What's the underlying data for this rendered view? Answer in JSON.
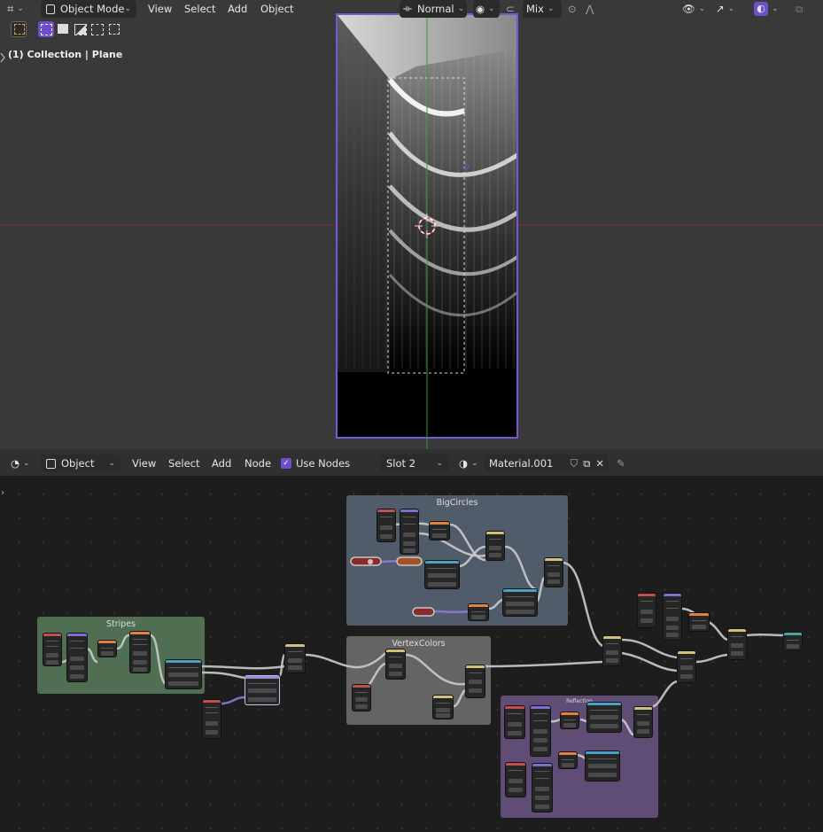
{
  "viewport": {
    "header": {
      "mode_label": "Object Mode",
      "menus": [
        "View",
        "Select",
        "Add",
        "Object"
      ],
      "orientation_label": "Normal",
      "snap_label": "Mix"
    },
    "overlay_text": "(1) Collection | Plane"
  },
  "node_editor": {
    "header": {
      "object_label": "Object",
      "menus": [
        "View",
        "Select",
        "Add",
        "Node"
      ],
      "use_nodes_label": "Use Nodes",
      "use_nodes_checked": true,
      "slot_label": "Slot 2",
      "material_name": "Material.001"
    },
    "frames": [
      {
        "name": "frame-stripes",
        "label": "Stripes"
      },
      {
        "name": "frame-bigcircles",
        "label": "BigCircles"
      },
      {
        "name": "frame-vertexcolors",
        "label": "VertexColors"
      },
      {
        "name": "frame-purple",
        "label": "Reflection"
      }
    ]
  },
  "colors": {
    "accent_purple": "#6f4fc9",
    "frame_stripes": "#4f6e52",
    "frame_bigcircles": "#515c6b",
    "frame_vertexcolors": "#646464",
    "frame_purple": "#5f4d75",
    "x_axis": "#8a2a2a",
    "y_axis": "#3b8f3b"
  }
}
